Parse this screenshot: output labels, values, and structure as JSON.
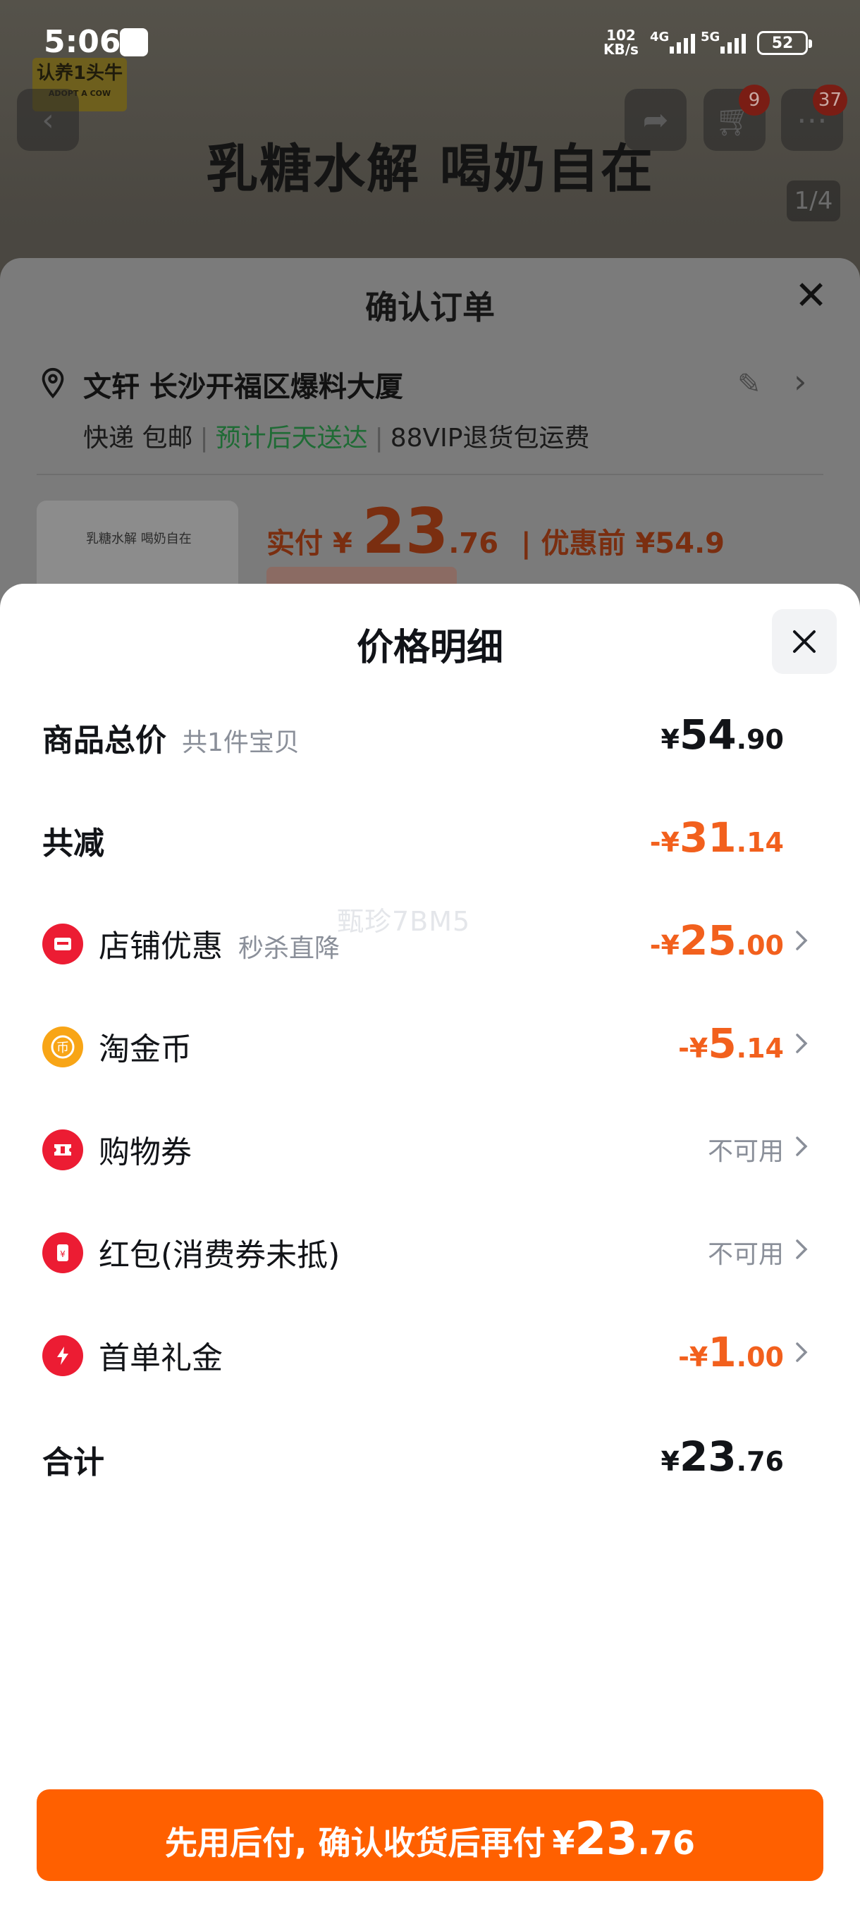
{
  "status_bar": {
    "time": "5:06",
    "net_speed_value": "102",
    "net_speed_unit": "KB/s",
    "network_1": "4G",
    "network_2": "5G",
    "battery": "52"
  },
  "background_page": {
    "brand_logo_text": "认养1头牛",
    "brand_logo_sub": "ADOPT A COW",
    "cart_badge": "9",
    "message_badge": "37",
    "headline": "乳糖水解 喝奶自在",
    "image_indicator": "1/4"
  },
  "confirm_order": {
    "title": "确认订单",
    "address": "文轩 长沙开福区爆料大厦",
    "shipping_method": "快递 包邮",
    "delivery_estimate": "预计后天送达",
    "return_shipping": "88VIP退货包运费",
    "product_thumb_text": "乳糖水解 喝奶自在",
    "paid_label": "实付",
    "paid_currency": "¥",
    "paid_int": "23",
    "paid_dec": ".76",
    "paid_separator": "|",
    "before_discount": "优惠前 ¥54.9"
  },
  "price_detail": {
    "title": "价格明细",
    "watermark": "甄珍7BM5",
    "rows": [
      {
        "label": "商品总价",
        "note": "共1件宝贝",
        "cur": "¥",
        "int": "54",
        "dec": ".90"
      },
      {
        "label": "共减",
        "cur": "-¥",
        "int": "31",
        "dec": ".14"
      },
      {
        "label": "店铺优惠",
        "note": "秒杀直降",
        "cur": "-¥",
        "int": "25",
        "dec": ".00",
        "icon": "store-icon",
        "color": "#f2601d"
      },
      {
        "label": "淘金币",
        "cur": "-¥",
        "int": "5",
        "dec": ".14",
        "icon": "coin-icon",
        "color": "#f2601d"
      },
      {
        "label": "购物券",
        "status": "不可用",
        "icon": "coupon-icon"
      },
      {
        "label": "红包(消费券未抵)",
        "status": "不可用",
        "icon": "red-envelope-icon"
      },
      {
        "label": "首单礼金",
        "cur": "-¥",
        "int": "1",
        "dec": ".00",
        "icon": "lightning-icon",
        "color": "#f2601d"
      },
      {
        "label": "合计",
        "cur": "¥",
        "int": "23",
        "dec": ".76"
      }
    ]
  },
  "pay_button": {
    "text": "先用后付, 确认收货后再付",
    "cur": "¥",
    "int": "23",
    "dec": ".76",
    "color": "#ff6000"
  }
}
